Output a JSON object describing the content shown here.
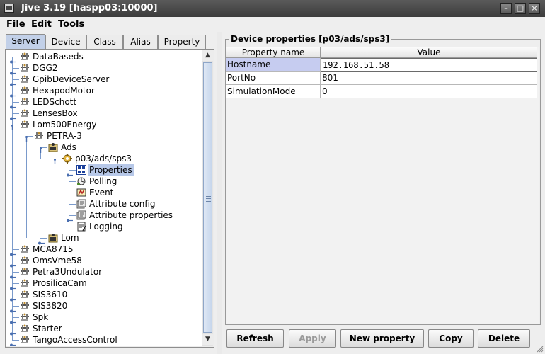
{
  "window": {
    "title": "Jive 3.19  [haspp03:10000]"
  },
  "menu": {
    "items": [
      "File",
      "Edit",
      "Tools"
    ]
  },
  "tabs": [
    "Server",
    "Device",
    "Class",
    "Alias",
    "Property"
  ],
  "selected_tab": "Server",
  "tree": {
    "rows": [
      {
        "label": "DataBaseds",
        "icon": "server-icon"
      },
      {
        "label": "DGG2",
        "icon": "server-icon"
      },
      {
        "label": "GpibDeviceServer",
        "icon": "server-icon"
      },
      {
        "label": "HexapodMotor",
        "icon": "server-icon"
      },
      {
        "label": "LEDSchott",
        "icon": "server-icon"
      },
      {
        "label": "LensesBox",
        "icon": "server-icon"
      },
      {
        "label": "Lom500Energy",
        "icon": "server-icon"
      },
      {
        "label": "PETRA-3",
        "icon": "server-icon"
      },
      {
        "label": "Ads",
        "icon": "class-icon"
      },
      {
        "label": "p03/ads/sps3",
        "icon": "device-icon"
      },
      {
        "label": "Properties",
        "icon": "properties-icon"
      },
      {
        "label": "Polling",
        "icon": "polling-icon"
      },
      {
        "label": "Event",
        "icon": "event-icon"
      },
      {
        "label": "Attribute config",
        "icon": "attribute-config-icon"
      },
      {
        "label": "Attribute properties",
        "icon": "attribute-properties-icon"
      },
      {
        "label": "Logging",
        "icon": "logging-icon"
      },
      {
        "label": "Lom",
        "icon": "class-icon"
      },
      {
        "label": "MCA8715",
        "icon": "server-icon"
      },
      {
        "label": "OmsVme58",
        "icon": "server-icon"
      },
      {
        "label": "Petra3Undulator",
        "icon": "server-icon"
      },
      {
        "label": "ProsilicaCam",
        "icon": "server-icon"
      },
      {
        "label": "SIS3610",
        "icon": "server-icon"
      },
      {
        "label": "SIS3820",
        "icon": "server-icon"
      },
      {
        "label": "Spk",
        "icon": "server-icon"
      },
      {
        "label": "Starter",
        "icon": "server-icon"
      },
      {
        "label": "TangoAccessControl",
        "icon": "server-icon"
      }
    ],
    "selected": "Properties"
  },
  "device_panel": {
    "title": "Device properties [p03/ads/sps3]",
    "columns": [
      "Property name",
      "Value"
    ],
    "rows": [
      {
        "name": "Hostname",
        "value": "192.168.51.58"
      },
      {
        "name": "PortNo",
        "value": "801"
      },
      {
        "name": "SimulationMode",
        "value": "0"
      }
    ]
  },
  "buttons": {
    "refresh": "Refresh",
    "apply": "Apply",
    "new_property": "New property",
    "copy": "Copy",
    "delete": "Delete"
  },
  "colors": {
    "selection": "#c6ccf0",
    "tab_selected": "#c2d0e8",
    "titlebar": "#4a4a4a"
  }
}
